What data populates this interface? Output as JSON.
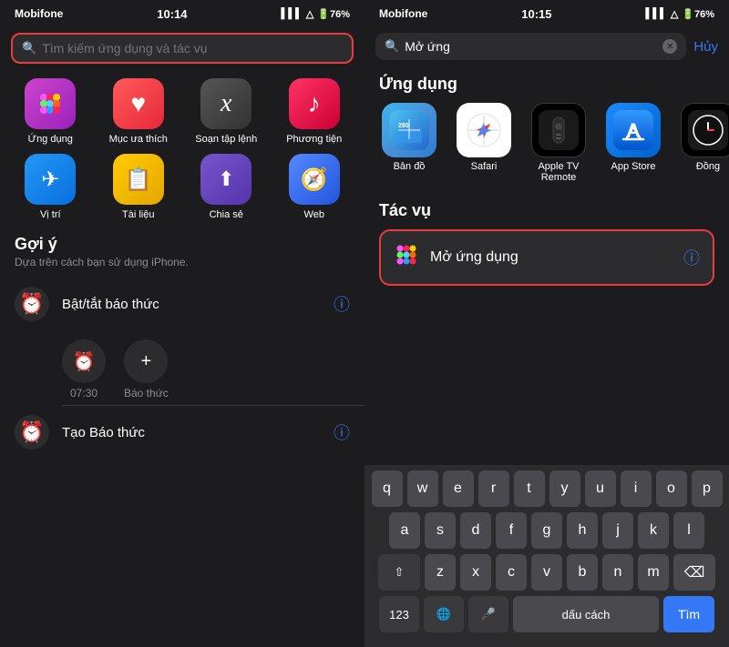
{
  "left": {
    "statusBar": {
      "carrier": "Mobifone",
      "time": "10:14",
      "rightIcons": "76%"
    },
    "searchPlaceholder": "Tìm kiếm ứng dụng và tác vụ",
    "shortcuts": [
      {
        "id": "apps",
        "icon": "⊞",
        "label": "Ứng dụng"
      },
      {
        "id": "favs",
        "icon": "♥",
        "label": "Mục ưa thích"
      },
      {
        "id": "shortcuts",
        "icon": "✕",
        "label": "Soạn tập lệnh"
      },
      {
        "id": "media",
        "icon": "♪",
        "label": "Phương tiện"
      },
      {
        "id": "location",
        "icon": "▶",
        "label": "Vị trí"
      },
      {
        "id": "docs",
        "icon": "📄",
        "label": "Tài liệu"
      },
      {
        "id": "share",
        "icon": "⬆",
        "label": "Chia sẻ"
      },
      {
        "id": "web",
        "icon": "🧭",
        "label": "Web"
      }
    ],
    "goiY": {
      "title": "Gợi ý",
      "subtitle": "Dựa trên cách bạn sử dụng iPhone.",
      "items": [
        {
          "icon": "⏰",
          "label": "Bật/tắt báo thức"
        },
        {
          "icon": "⏰",
          "label": "Tạo Báo thức"
        }
      ],
      "alarmTime": "07:30",
      "alarmLabel": "Báo thức"
    }
  },
  "right": {
    "statusBar": {
      "carrier": "Mobifone",
      "time": "10:15",
      "rightIcons": "76%"
    },
    "searchText": "Mở ứng",
    "cancelLabel": "Hủy",
    "ungDungTitle": "Ứng dụng",
    "apps": [
      {
        "id": "maps",
        "label": "Bản đồ"
      },
      {
        "id": "safari",
        "label": "Safari"
      },
      {
        "id": "appletv",
        "label": "Apple TV Remote"
      },
      {
        "id": "appstore",
        "label": "App Store"
      },
      {
        "id": "clock",
        "label": "Đồng"
      }
    ],
    "tacVuTitle": "Tác vụ",
    "taskItem": {
      "icon": "⊞",
      "label": "Mở ứng dụng"
    },
    "keyboard": {
      "row1": [
        "q",
        "w",
        "e",
        "r",
        "t",
        "y",
        "u",
        "i",
        "o",
        "p"
      ],
      "row2": [
        "a",
        "s",
        "d",
        "f",
        "g",
        "h",
        "j",
        "k",
        "l"
      ],
      "row3": [
        "z",
        "x",
        "c",
        "v",
        "b",
        "n",
        "m"
      ],
      "row4Numbers": "123",
      "row4Space": "dấu cách",
      "row4Search": "Tìm"
    }
  }
}
